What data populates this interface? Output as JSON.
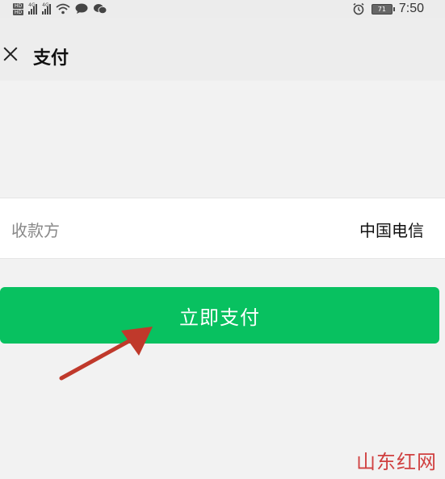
{
  "status_bar": {
    "network_left": "4G",
    "network_right": "4G",
    "hd_badge_top": "HD",
    "hd_badge_bottom": "HD",
    "battery": "71",
    "time": "7:50"
  },
  "nav": {
    "title": "支付"
  },
  "payee": {
    "label": "收款方",
    "value": "中国电信"
  },
  "pay_button": {
    "label": "立即支付"
  },
  "watermark": {
    "text": "山东红网"
  },
  "colors": {
    "accent_green": "#08c160",
    "arrow_red": "#c0392b",
    "watermark_red": "#d04040"
  }
}
